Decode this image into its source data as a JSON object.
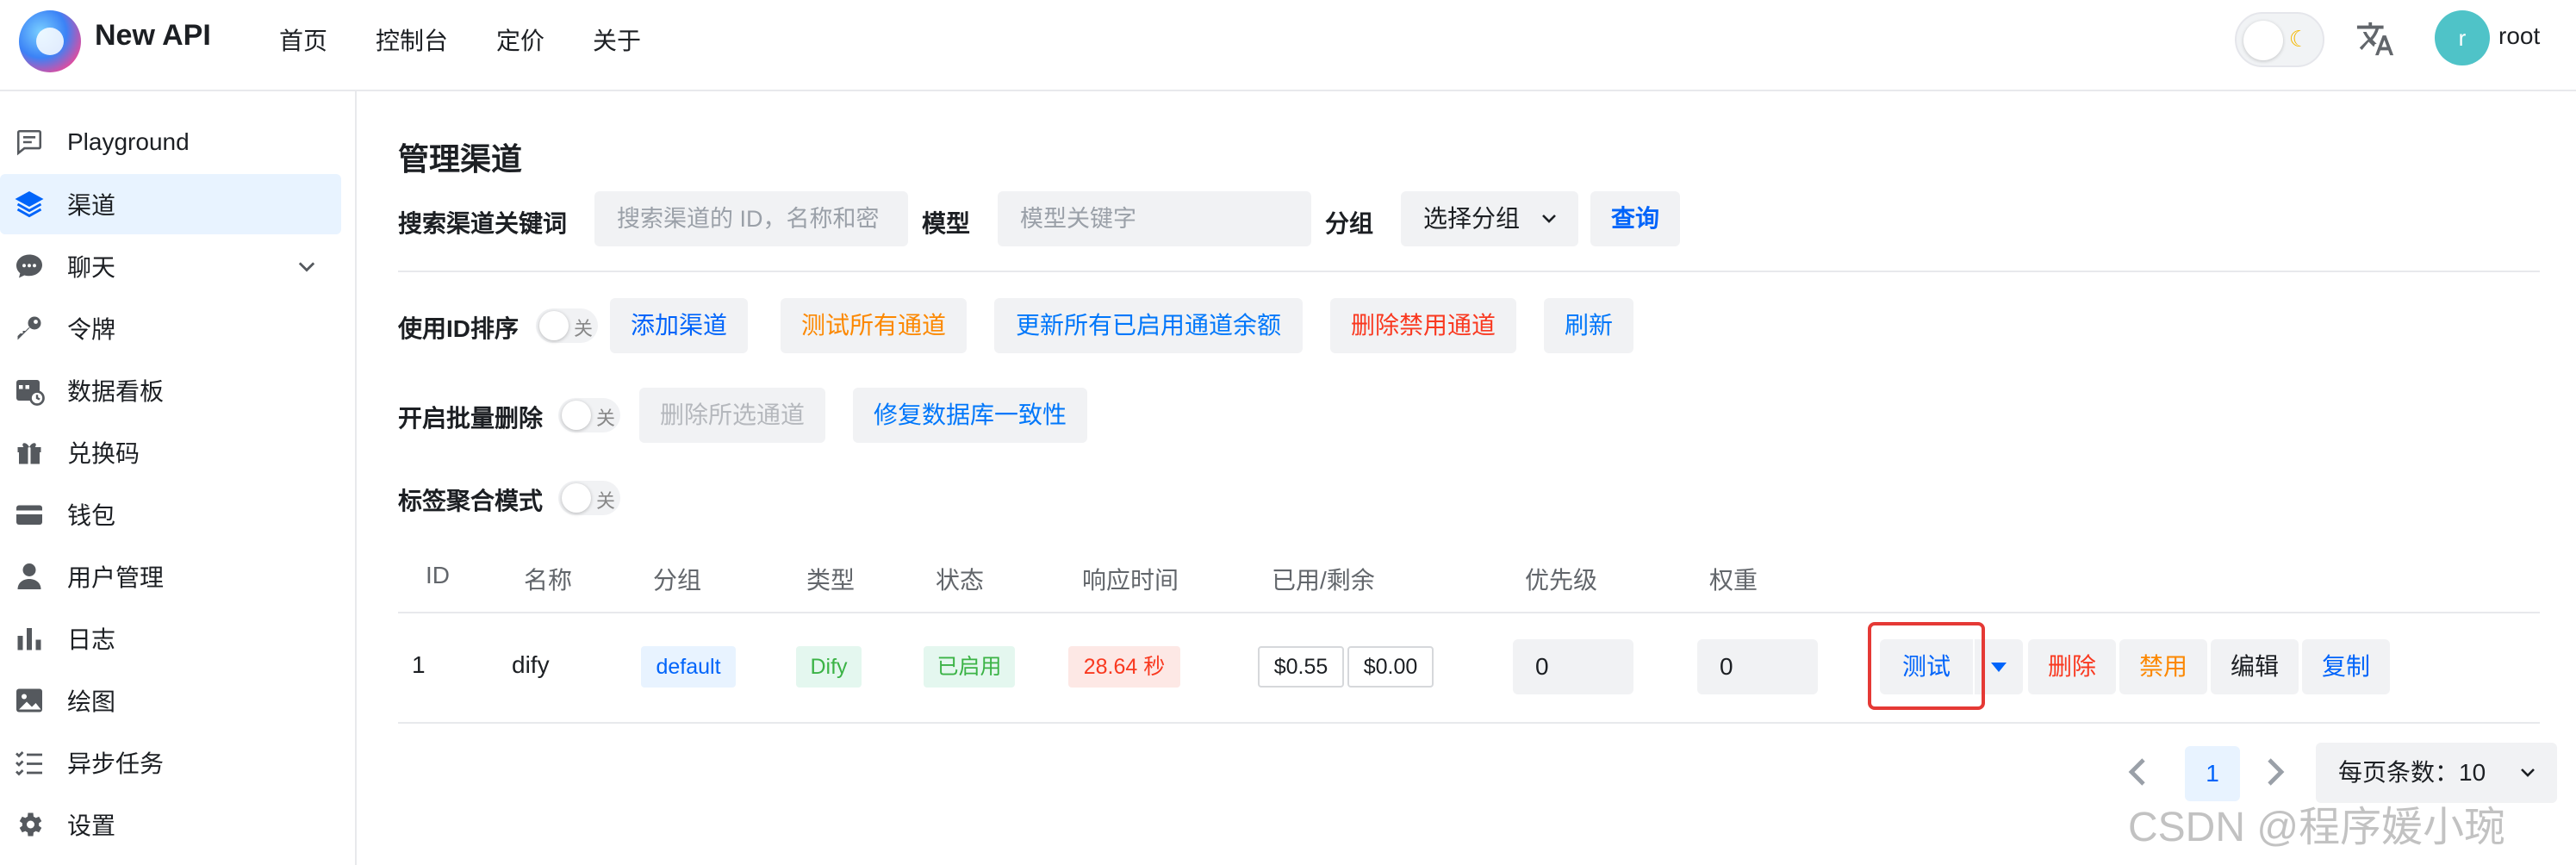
{
  "app": {
    "brand": "New API",
    "user_initial": "r",
    "username": "root"
  },
  "topnav": [
    "首页",
    "控制台",
    "定价",
    "关于"
  ],
  "sidebar": {
    "items": [
      {
        "label": "Playground",
        "icon": "chat-box-icon"
      },
      {
        "label": "渠道",
        "icon": "layers-icon",
        "active": true
      },
      {
        "label": "聊天",
        "icon": "chat-bubble-icon",
        "expandable": true
      },
      {
        "label": "令牌",
        "icon": "key-icon"
      },
      {
        "label": "数据看板",
        "icon": "calendar-chart-icon"
      },
      {
        "label": "兑换码",
        "icon": "gift-icon"
      },
      {
        "label": "钱包",
        "icon": "wallet-icon"
      },
      {
        "label": "用户管理",
        "icon": "user-icon"
      },
      {
        "label": "日志",
        "icon": "bar-chart-icon"
      },
      {
        "label": "绘图",
        "icon": "image-icon"
      },
      {
        "label": "异步任务",
        "icon": "checklist-icon"
      },
      {
        "label": "设置",
        "icon": "gear-icon"
      }
    ]
  },
  "main": {
    "title": "管理渠道",
    "search": {
      "keyword_label": "搜索渠道关键词",
      "keyword_placeholder": "搜索渠道的 ID，名称和密",
      "model_label": "模型",
      "model_placeholder": "模型关键字",
      "group_label": "分组",
      "group_select": "选择分组",
      "query_button": "查询"
    },
    "row1": {
      "sort_label": "使用ID排序",
      "switch_off": "关",
      "add_channel": "添加渠道",
      "test_all": "测试所有通道",
      "update_balance": "更新所有已启用通道余额",
      "delete_disabled": "删除禁用通道",
      "refresh": "刷新"
    },
    "row2": {
      "batch_delete_label": "开启批量删除",
      "switch_off": "关",
      "delete_selected": "删除所选通道",
      "fix_db": "修复数据库一致性"
    },
    "row3": {
      "tag_mode_label": "标签聚合模式",
      "switch_off": "关"
    },
    "table": {
      "headers": [
        "ID",
        "名称",
        "分组",
        "类型",
        "状态",
        "响应时间",
        "已用/剩余",
        "优先级",
        "权重"
      ],
      "rows": [
        {
          "id": "1",
          "name": "dify",
          "group": "default",
          "type": "Dify",
          "status": "已启用",
          "response_time": "28.64 秒",
          "used": "$0.55",
          "remaining": "$0.00",
          "priority": "0",
          "weight": "0",
          "actions": {
            "test": "测试",
            "delete": "删除",
            "disable": "禁用",
            "edit": "编辑",
            "copy": "复制"
          }
        }
      ]
    },
    "pagination": {
      "current_page": "1",
      "page_size_label": "每页条数：10"
    }
  },
  "watermark": "CSDN @程序媛小琬",
  "colors": {
    "primary": "#0064fa",
    "danger": "#f93920",
    "warning": "#fc8800",
    "highlight_border": "#e53935"
  }
}
